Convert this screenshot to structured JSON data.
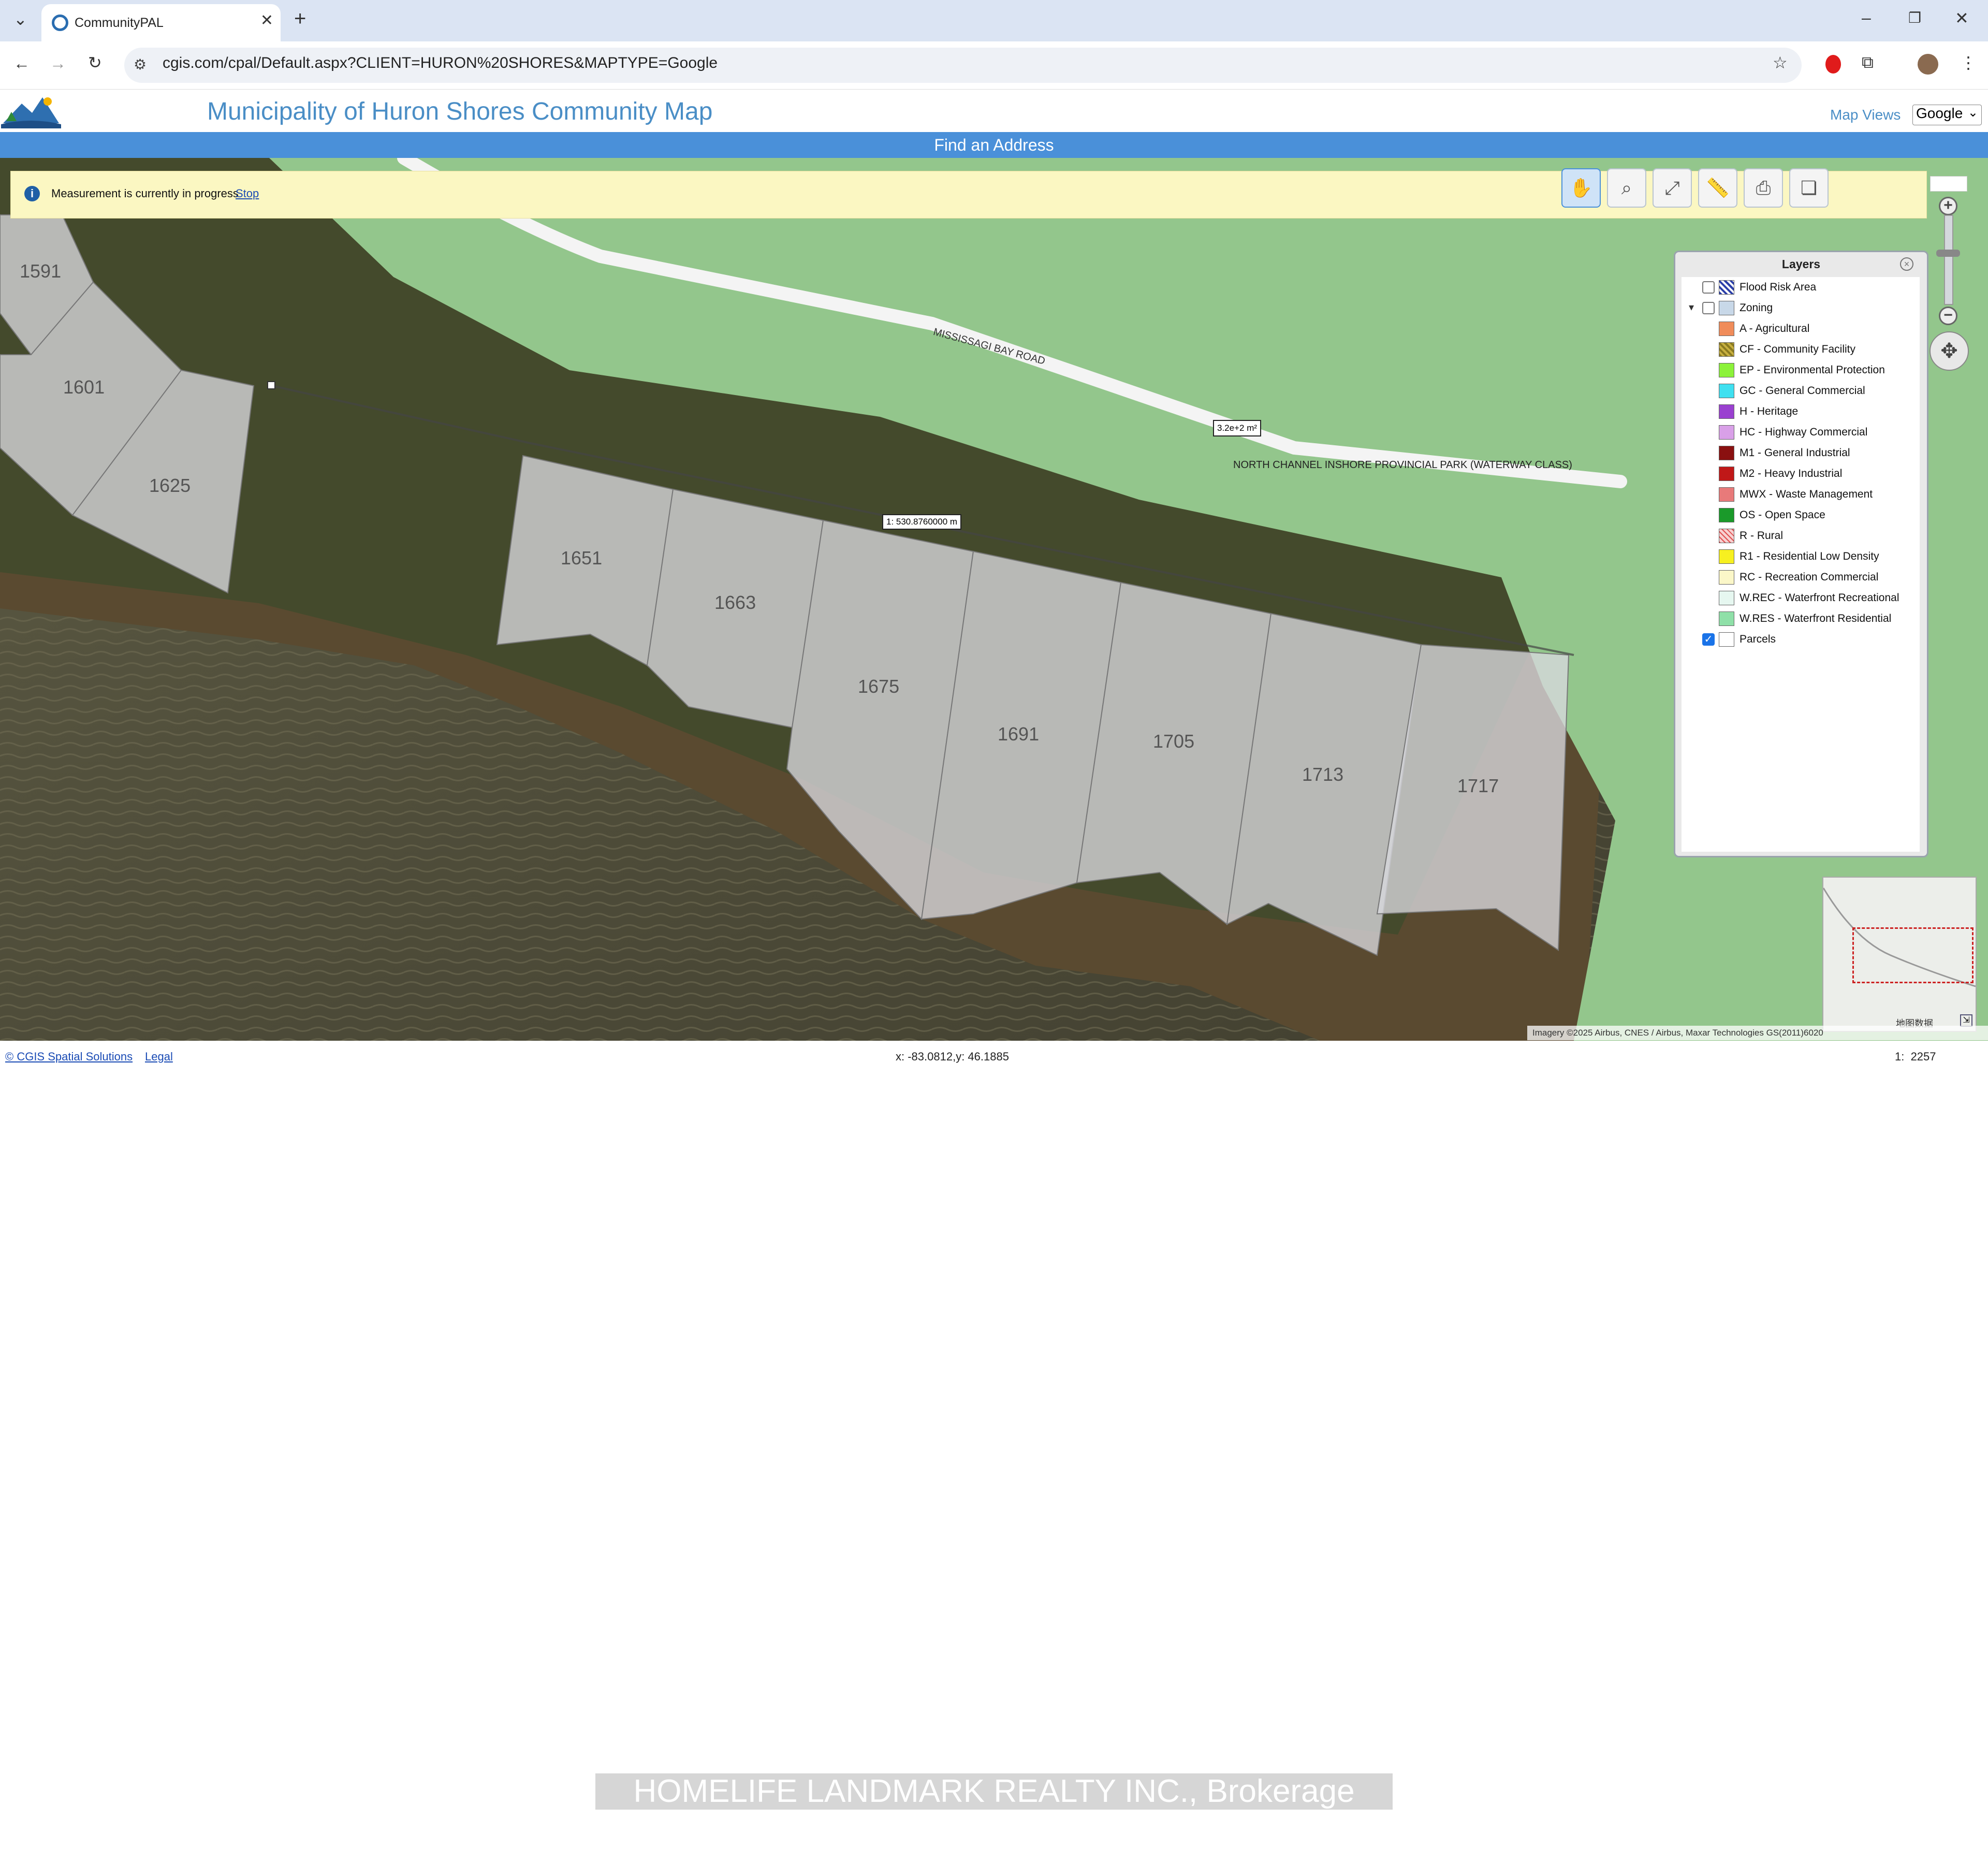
{
  "browser": {
    "tab_title": "CommunityPAL",
    "url": "cgis.com/cpal/Default.aspx?CLIENT=HURON%20SHORES&MAPTYPE=Google",
    "new_tab": "+",
    "tab_close": "✕",
    "win_min": "–",
    "win_restore": "❐",
    "win_close": "✕"
  },
  "app": {
    "title": "Municipality of Huron Shores Community Map",
    "map_views_label": "Map Views",
    "map_type_selected": "Google",
    "find_address": "Find an Address"
  },
  "measurement": {
    "message": "Measurement is currently in progress",
    "stop": "Stop",
    "area_label": "3.2e+2 m²",
    "distance_label": "1: 530.8760000 m"
  },
  "map": {
    "road_label": "MISSISSAGI BAY ROAD",
    "park_label": "NORTH CHANNEL INSHORE PROVINCIAL PARK (WATERWAY CLASS)",
    "parcels": [
      "1591",
      "1601",
      "1625",
      "1651",
      "1663",
      "1675",
      "1691",
      "1705",
      "1713",
      "1717"
    ],
    "attribution": "Imagery ©2025 Airbus, CNES / Airbus, Maxar Technologies GS(2011)6020",
    "minimap_caption": "地图数据"
  },
  "layers": {
    "title": "Layers",
    "items": [
      {
        "label": "Flood Risk Area",
        "color": "#2b3fa8",
        "checked": false
      },
      {
        "label": "Zoning",
        "color": "#c8d8e8",
        "checked": false
      },
      {
        "label": "A - Agricultural",
        "color": "#f08c5a"
      },
      {
        "label": "CF - Community Facility",
        "color": "#8a7a20"
      },
      {
        "label": "EP - Environmental Protection",
        "color": "#8cf23a"
      },
      {
        "label": "GC - General Commercial",
        "color": "#3fe0f0"
      },
      {
        "label": "H - Heritage",
        "color": "#9a40d0"
      },
      {
        "label": "HC - Highway Commercial",
        "color": "#d9a0e8"
      },
      {
        "label": "M1 - General Industrial",
        "color": "#8a1010"
      },
      {
        "label": "M2 - Heavy Industrial",
        "color": "#c01818"
      },
      {
        "label": "MWX - Waste Management",
        "color": "#e87a7a"
      },
      {
        "label": "OS - Open Space",
        "color": "#1a9a2a"
      },
      {
        "label": "R - Rural",
        "color": "#f7d0d0"
      },
      {
        "label": "R1 - Residential Low Density",
        "color": "#f7f020"
      },
      {
        "label": "RC - Recreation Commercial",
        "color": "#fbf7c8"
      },
      {
        "label": "W.REC - Waterfront Recreational",
        "color": "#e6f7f0"
      },
      {
        "label": "W.RES - Waterfront Residential",
        "color": "#8fe0a8"
      },
      {
        "label": "Parcels",
        "color": "#ffffff",
        "checked": true
      }
    ]
  },
  "status": {
    "copyright": "© CGIS Spatial Solutions",
    "legal": "Legal",
    "coords": "x: -83.0812,y: 46.1885",
    "scale": "1:  2257"
  },
  "watermark": "HOMELIFE LANDMARK REALTY INC., Brokerage"
}
